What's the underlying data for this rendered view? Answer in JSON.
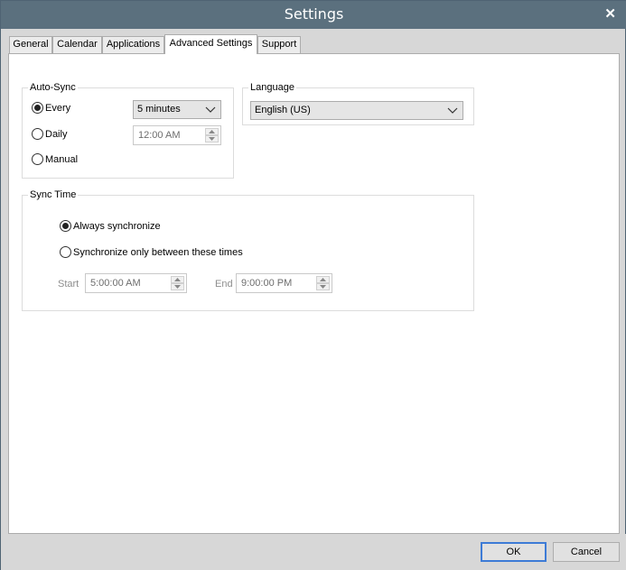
{
  "window": {
    "title": "Settings",
    "close_glyph": "✕"
  },
  "tabs": [
    {
      "label": "General",
      "active": false
    },
    {
      "label": "Calendar",
      "active": false
    },
    {
      "label": "Applications",
      "active": false
    },
    {
      "label": "Advanced Settings",
      "active": true
    },
    {
      "label": "Support",
      "active": false
    }
  ],
  "auto_sync": {
    "title": "Auto-Sync",
    "options": [
      {
        "label": "Every",
        "selected": true
      },
      {
        "label": "Daily",
        "selected": false
      },
      {
        "label": "Manual",
        "selected": false
      }
    ],
    "every_value": "5 minutes",
    "daily_time": "12:00 AM"
  },
  "language": {
    "title": "Language",
    "value": "English (US)"
  },
  "sync_time": {
    "title": "Sync Time",
    "options": [
      {
        "label": "Always synchronize",
        "selected": true
      },
      {
        "label": "Synchronize only between these times",
        "selected": false
      }
    ],
    "start_label": "Start",
    "start_value": "5:00:00 AM",
    "end_label": "End",
    "end_value": "9:00:00 PM"
  },
  "footer": {
    "ok_label": "OK",
    "cancel_label": "Cancel"
  },
  "icons": {
    "close": "close-icon",
    "dropdown": "chevron-down-icon",
    "spin_up": "spin-up-icon",
    "spin_down": "spin-down-icon"
  }
}
